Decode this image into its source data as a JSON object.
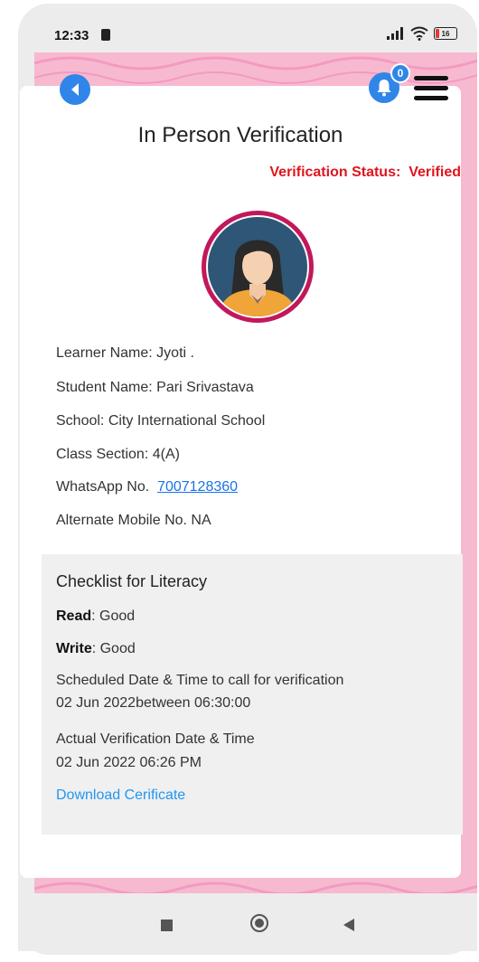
{
  "status_bar": {
    "time": "12:33",
    "battery": "16"
  },
  "header": {
    "notification_count": "0"
  },
  "page": {
    "title": "In Person Verification",
    "verification_status_label": "Verification Status:",
    "verification_status_value": "Verified"
  },
  "learner": {
    "learner_name": "Learner Name: Jyoti .",
    "student_name": "Student Name: Pari Srivastava",
    "school": "School: City International School",
    "class_section": "Class Section: 4(A)",
    "whatsapp_label": "WhatsApp No.",
    "whatsapp_number": "7007128360",
    "alternate_mobile": "Alternate Mobile No.  NA"
  },
  "checklist": {
    "title": "Checklist for Literacy",
    "read_label": "Read",
    "read_value": ": Good",
    "write_label": "Write",
    "write_value": ": Good",
    "scheduled_label": "Scheduled Date & Time to call for verification",
    "scheduled_value": "02 Jun 2022between 06:30:00",
    "actual_label": "Actual Verification Date & Time",
    "actual_value": "02 Jun 2022 06:26 PM",
    "download_link": "Download Cerificate"
  },
  "colors": {
    "accent": "#2f86e8",
    "status": "#e0141e",
    "pink_bg": "#f7b9d0",
    "avatar_ring": "#c2185b",
    "link": "#2196f3"
  }
}
